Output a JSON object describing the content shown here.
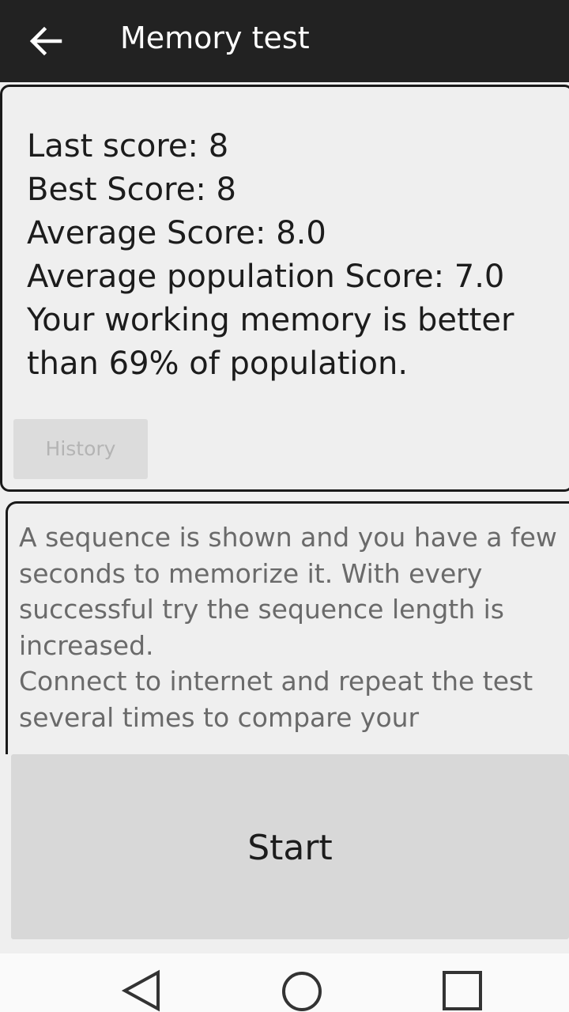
{
  "app_bar": {
    "back_icon": "arrow-left-icon",
    "title": "Memory test"
  },
  "scores": {
    "last_score": "Last score: 8",
    "best_score": "Best Score: 8",
    "average_score": "Average Score: 8.0",
    "population_score": "Average population Score: 7.0",
    "percentile_line1": "Your working memory is better",
    "percentile_line2": "than 69% of population.",
    "history_label": "History"
  },
  "description": {
    "lines": [
      "A sequence is shown and you have a few",
      "seconds to memorize it. With every",
      "successful try the sequence length is",
      "increased.",
      "Connect to internet and repeat the test",
      "several times to compare your"
    ]
  },
  "start_label": "Start",
  "nav_bar": {
    "back_icon": "triangle-back-icon",
    "home_icon": "circle-home-icon",
    "recents_icon": "square-recents-icon"
  },
  "colors": {
    "app_bar": "#222222",
    "background": "#efefef",
    "button": "#d8d8d8",
    "disabled_text": "#b4b4b4"
  }
}
